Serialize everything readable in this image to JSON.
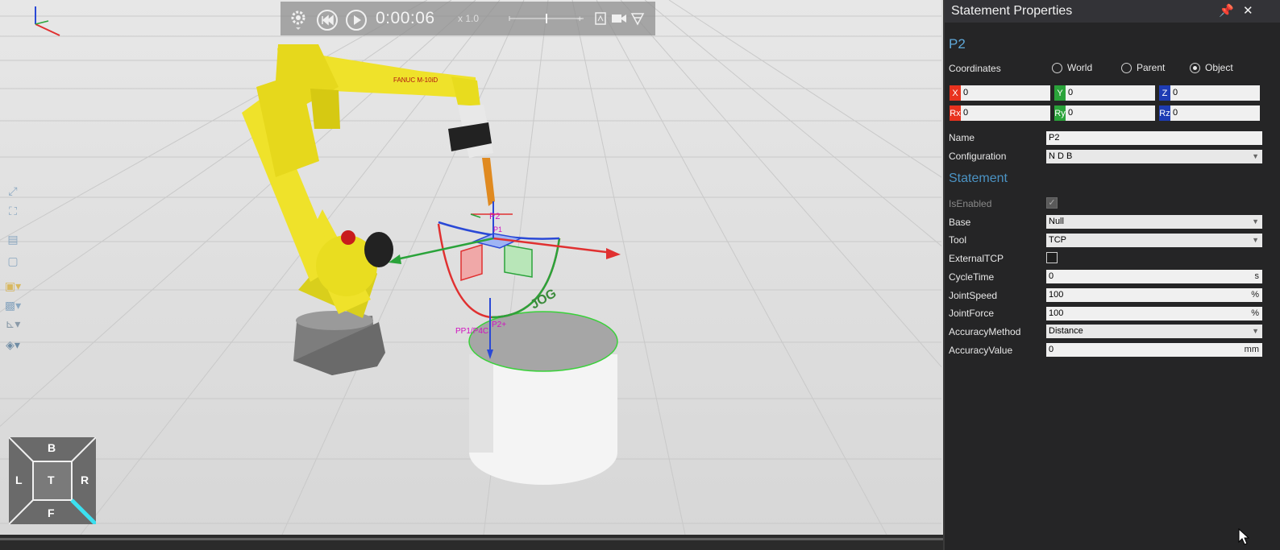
{
  "playback": {
    "time": "0:00:06",
    "speed": "x 1.0"
  },
  "viewcube": {
    "back": "B",
    "left": "L",
    "top": "T",
    "right": "R",
    "front": "F"
  },
  "scene_labels": {
    "robot_brand": "FANUC M-10iD",
    "target_top": "P2",
    "target_small": "P1",
    "jog": "JOG",
    "base_points": "PP1/P4C",
    "base_point2": "P2+"
  },
  "panel": {
    "title": "Statement Properties",
    "item_name": "P2",
    "coordinates_label": "Coordinates",
    "coord_options": [
      "World",
      "Parent",
      "Object"
    ],
    "coord_selected": "Object",
    "fields": {
      "x": {
        "tag": "X",
        "value": "0",
        "color": "#e8321e"
      },
      "y": {
        "tag": "Y",
        "value": "0",
        "color": "#2aa33a"
      },
      "z": {
        "tag": "Z",
        "value": "0",
        "color": "#1e3cb4"
      },
      "rx": {
        "tag": "Rx",
        "value": "0",
        "color": "#e8321e"
      },
      "ry": {
        "tag": "Ry",
        "value": "0",
        "color": "#2aa33a"
      },
      "rz": {
        "tag": "Rz",
        "value": "0",
        "color": "#1e3cb4"
      }
    },
    "name_label": "Name",
    "name_value": "P2",
    "configuration_label": "Configuration",
    "configuration_value": "N D B",
    "statement_section": "Statement",
    "isenabled_label": "IsEnabled",
    "isenabled_value": true,
    "base_label": "Base",
    "base_value": "Null",
    "tool_label": "Tool",
    "tool_value": "TCP",
    "externaltcp_label": "ExternalTCP",
    "externaltcp_value": false,
    "cycletime_label": "CycleTime",
    "cycletime_value": "0",
    "cycletime_unit": "s",
    "jointspeed_label": "JointSpeed",
    "jointspeed_value": "100",
    "jointspeed_unit": "%",
    "jointforce_label": "JointForce",
    "jointforce_value": "100",
    "jointforce_unit": "%",
    "accuracymethod_label": "AccuracyMethod",
    "accuracymethod_value": "Distance",
    "accuracyvalue_label": "AccuracyValue",
    "accuracyvalue_value": "0",
    "accuracyvalue_unit": "mm"
  }
}
